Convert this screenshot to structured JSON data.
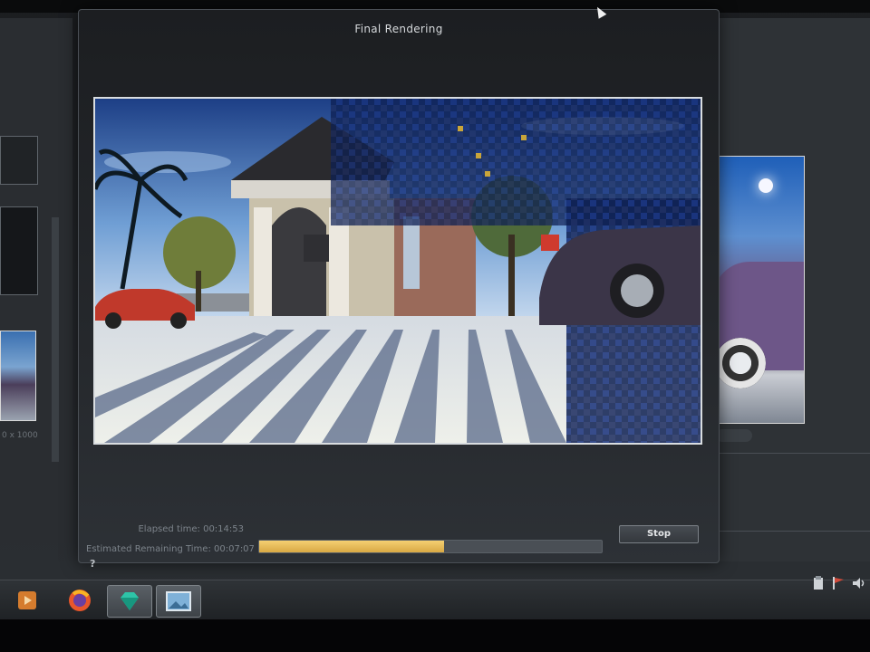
{
  "dialog": {
    "title": "Final Rendering",
    "elapsed_label": "Elapsed time: 00:14:53",
    "remaining_label": "Estimated Remaining Time: 00:07:07",
    "progress_fraction": 0.54,
    "stop_label": "Stop",
    "help_label": "?"
  },
  "left_panel": {
    "resolution_text": "0 x 1000"
  },
  "taskbar": {
    "apps": [
      {
        "icon": "media-player-icon"
      },
      {
        "icon": "firefox-icon"
      },
      {
        "icon": "gem-app-icon"
      },
      {
        "icon": "image-viewer-icon"
      }
    ],
    "tray": [
      {
        "icon": "clipboard-icon"
      },
      {
        "icon": "flag-icon"
      },
      {
        "icon": "volume-icon"
      }
    ]
  },
  "colors": {
    "progress": "#e2b452",
    "accent_sky": "#2a5ab0"
  }
}
